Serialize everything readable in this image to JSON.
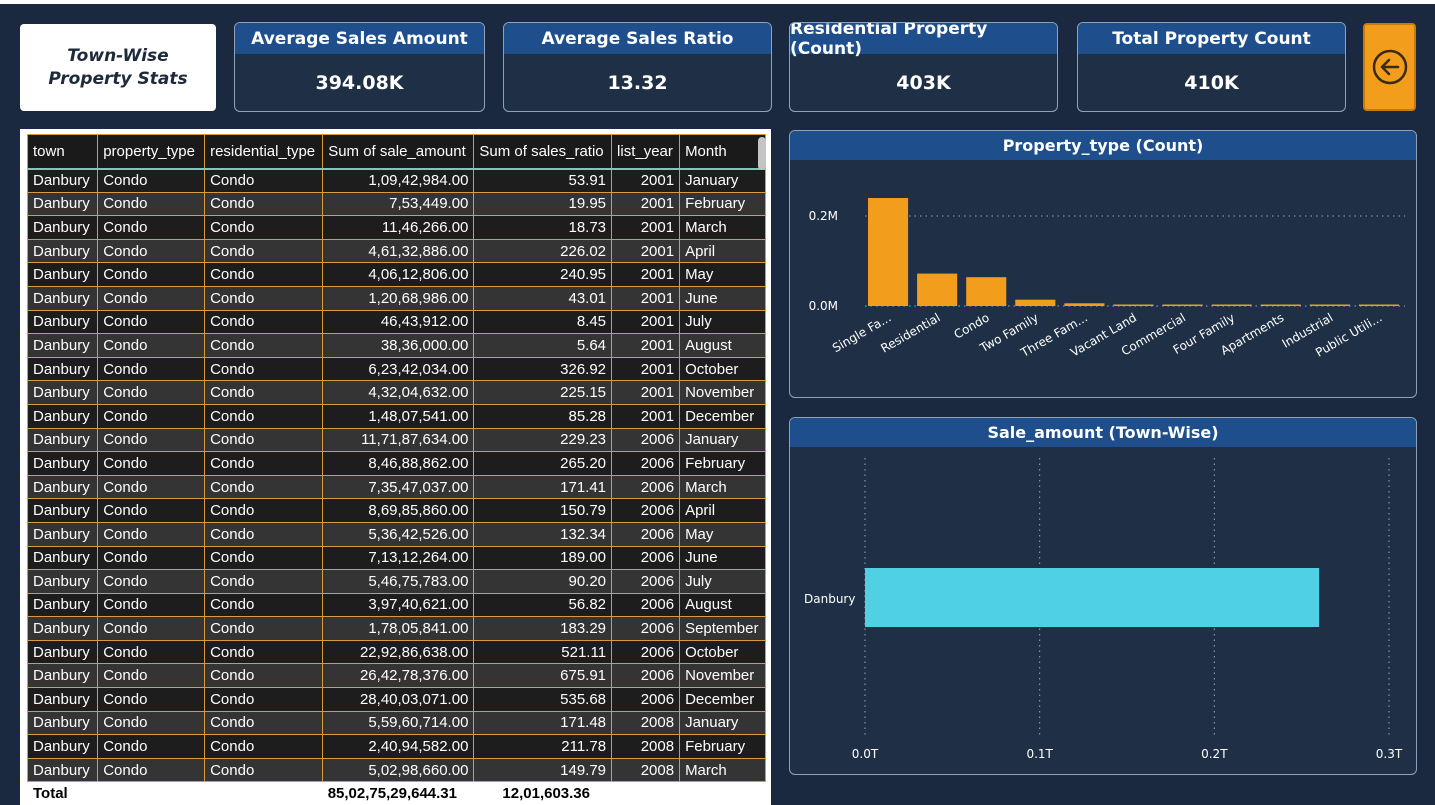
{
  "title": "Town-Wise Property Stats",
  "cards": [
    {
      "label": "Average Sales Amount",
      "value": "394.08K"
    },
    {
      "label": "Average Sales Ratio",
      "value": "13.32"
    },
    {
      "label": "Residential Property (Count)",
      "value": "403K"
    },
    {
      "label": "Total Property Count",
      "value": "410K"
    }
  ],
  "back_button": {
    "icon": "arrow-left-circle-icon",
    "color": "#f29d1c"
  },
  "table": {
    "columns": [
      "town",
      "property_type",
      "residential_type",
      "Sum of sale_amount",
      "Sum of sales_ratio",
      "list_year",
      "Month"
    ],
    "rows": [
      [
        "Danbury",
        "Condo",
        "Condo",
        "1,09,42,984.00",
        "53.91",
        "2001",
        "January"
      ],
      [
        "Danbury",
        "Condo",
        "Condo",
        "7,53,449.00",
        "19.95",
        "2001",
        "February"
      ],
      [
        "Danbury",
        "Condo",
        "Condo",
        "11,46,266.00",
        "18.73",
        "2001",
        "March"
      ],
      [
        "Danbury",
        "Condo",
        "Condo",
        "4,61,32,886.00",
        "226.02",
        "2001",
        "April"
      ],
      [
        "Danbury",
        "Condo",
        "Condo",
        "4,06,12,806.00",
        "240.95",
        "2001",
        "May"
      ],
      [
        "Danbury",
        "Condo",
        "Condo",
        "1,20,68,986.00",
        "43.01",
        "2001",
        "June"
      ],
      [
        "Danbury",
        "Condo",
        "Condo",
        "46,43,912.00",
        "8.45",
        "2001",
        "July"
      ],
      [
        "Danbury",
        "Condo",
        "Condo",
        "38,36,000.00",
        "5.64",
        "2001",
        "August"
      ],
      [
        "Danbury",
        "Condo",
        "Condo",
        "6,23,42,034.00",
        "326.92",
        "2001",
        "October"
      ],
      [
        "Danbury",
        "Condo",
        "Condo",
        "4,32,04,632.00",
        "225.15",
        "2001",
        "November"
      ],
      [
        "Danbury",
        "Condo",
        "Condo",
        "1,48,07,541.00",
        "85.28",
        "2001",
        "December"
      ],
      [
        "Danbury",
        "Condo",
        "Condo",
        "11,71,87,634.00",
        "229.23",
        "2006",
        "January"
      ],
      [
        "Danbury",
        "Condo",
        "Condo",
        "8,46,88,862.00",
        "265.20",
        "2006",
        "February"
      ],
      [
        "Danbury",
        "Condo",
        "Condo",
        "7,35,47,037.00",
        "171.41",
        "2006",
        "March"
      ],
      [
        "Danbury",
        "Condo",
        "Condo",
        "8,69,85,860.00",
        "150.79",
        "2006",
        "April"
      ],
      [
        "Danbury",
        "Condo",
        "Condo",
        "5,36,42,526.00",
        "132.34",
        "2006",
        "May"
      ],
      [
        "Danbury",
        "Condo",
        "Condo",
        "7,13,12,264.00",
        "189.00",
        "2006",
        "June"
      ],
      [
        "Danbury",
        "Condo",
        "Condo",
        "5,46,75,783.00",
        "90.20",
        "2006",
        "July"
      ],
      [
        "Danbury",
        "Condo",
        "Condo",
        "3,97,40,621.00",
        "56.82",
        "2006",
        "August"
      ],
      [
        "Danbury",
        "Condo",
        "Condo",
        "1,78,05,841.00",
        "183.29",
        "2006",
        "September"
      ],
      [
        "Danbury",
        "Condo",
        "Condo",
        "22,92,86,638.00",
        "521.11",
        "2006",
        "October"
      ],
      [
        "Danbury",
        "Condo",
        "Condo",
        "26,42,78,376.00",
        "675.91",
        "2006",
        "November"
      ],
      [
        "Danbury",
        "Condo",
        "Condo",
        "28,40,03,071.00",
        "535.68",
        "2006",
        "December"
      ],
      [
        "Danbury",
        "Condo",
        "Condo",
        "5,59,60,714.00",
        "171.48",
        "2008",
        "January"
      ],
      [
        "Danbury",
        "Condo",
        "Condo",
        "2,40,94,582.00",
        "211.78",
        "2008",
        "February"
      ],
      [
        "Danbury",
        "Condo",
        "Condo",
        "5,02,98,660.00",
        "149.79",
        "2008",
        "March"
      ]
    ],
    "total": {
      "label": "Total",
      "sale_amount": "85,02,75,29,644.31",
      "sales_ratio": "12,01,603.36"
    }
  },
  "chart_data": [
    {
      "type": "bar",
      "title": "Property_type (Count)",
      "categories": [
        "Single Fa...",
        "Residential",
        "Condo",
        "Two Family",
        "Three Fam...",
        "Vacant Land",
        "Commercial",
        "Four Family",
        "Apartments",
        "Industrial",
        "Public Utili..."
      ],
      "values": [
        240000,
        72000,
        64000,
        14000,
        6000,
        2500,
        1500,
        1000,
        600,
        500,
        300
      ],
      "y_ticks": [
        "0.0M",
        "0.2M"
      ],
      "ylim": [
        0,
        250000
      ],
      "xlabel": "",
      "color": "#f29d1c"
    },
    {
      "type": "bar",
      "orientation": "horizontal",
      "title": "Sale_amount (Town-Wise)",
      "categories": [
        "Danbury"
      ],
      "values": [
        0.26
      ],
      "x_ticks": [
        "0.0T",
        "0.1T",
        "0.2T",
        "0.3T"
      ],
      "xlim": [
        0,
        0.3
      ],
      "color": "#4fd1e3"
    }
  ]
}
